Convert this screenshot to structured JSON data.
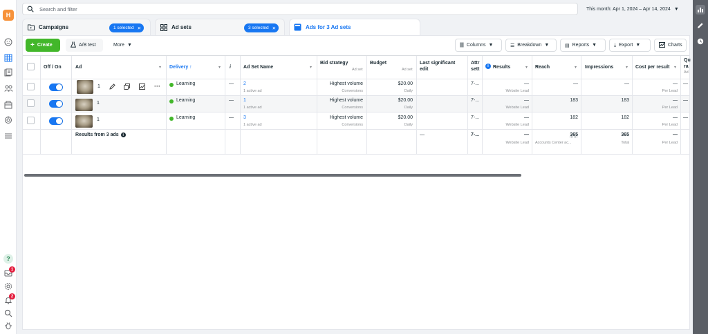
{
  "leftnav": {
    "brand_letter": "H",
    "badges": {
      "notifications_1": "1",
      "notifications_2": "2"
    },
    "help_glyph": "?"
  },
  "search": {
    "placeholder": "Search and filter"
  },
  "date_range": "This month: Apr 1, 2024 – Apr 14, 2024",
  "tabs": [
    {
      "label": "Campaigns",
      "icon": "folder-icon",
      "selected": "1 selected"
    },
    {
      "label": "Ad sets",
      "icon": "grid-icon",
      "selected": "3 selected"
    },
    {
      "label": "Ads for 3 Ad sets",
      "icon": "ad-icon"
    }
  ],
  "toolbar": {
    "create": "Create",
    "ab_test": "A/B test",
    "more": "More",
    "columns": "Columns",
    "breakdown": "Breakdown",
    "reports": "Reports",
    "export": "Export",
    "charts": "Charts"
  },
  "table": {
    "headers": {
      "off_on": "Off / On",
      "ad": "Ad",
      "delivery": "Delivery ↑",
      "info": "i",
      "ad_set_name": "Ad Set Name",
      "bid_strategy": "Bid strategy",
      "bid_strategy_sub": "Ad set",
      "budget": "Budget",
      "budget_sub": "Ad set",
      "last_edit_1": "Last significant",
      "last_edit_2": "edit",
      "attr_1": "Attr",
      "attr_2": "sett",
      "results": "Results",
      "reach": "Reach",
      "impressions": "Impressions",
      "cost_per_result": "Cost per result",
      "quality_1": "Qu",
      "quality_2": "ra",
      "quality_3": "Ad"
    },
    "rows": [
      {
        "ad": "1",
        "delivery": "Learning",
        "dash": "—",
        "ad_set": "2",
        "ad_set_sub": "1 active ad",
        "bid": "Highest volume",
        "bid_sub": "Conversions",
        "budget": "$20.00",
        "budget_sub": "Daily",
        "attr": "7-...",
        "results": "—",
        "results_sub": "Website Lead",
        "reach": "—",
        "impressions": "—",
        "cost": "—",
        "cost_sub": "Per Lead",
        "quality": "—"
      },
      {
        "ad": "1",
        "delivery": "Learning",
        "dash": "—",
        "ad_set": "1",
        "ad_set_sub": "1 active ad",
        "bid": "Highest volume",
        "bid_sub": "Conversions",
        "budget": "$20.00",
        "budget_sub": "Daily",
        "attr": "7-...",
        "results": "—",
        "results_sub": "Website Lead",
        "reach": "183",
        "impressions": "183",
        "cost": "—",
        "cost_sub": "Per Lead",
        "quality": "—"
      },
      {
        "ad": "1",
        "delivery": "Learning",
        "dash": "—",
        "ad_set": "3",
        "ad_set_sub": "1 active ad",
        "bid": "Highest volume",
        "bid_sub": "Conversions",
        "budget": "$20.00",
        "budget_sub": "Daily",
        "attr": "7-...",
        "results": "—",
        "results_sub": "Website Lead",
        "reach": "182",
        "impressions": "182",
        "cost": "—",
        "cost_sub": "Per Lead",
        "quality": "—"
      }
    ],
    "summary": {
      "label": "Results from 3 ads",
      "last_edit": "—",
      "attr": "7-...",
      "results": "—",
      "results_sub": "Website Lead",
      "reach": "365",
      "reach_sub": "Accounts Center ac...",
      "impressions": "365",
      "impressions_sub": "Total",
      "cost": "—",
      "cost_sub": "Per Lead"
    }
  },
  "colors": {
    "accent": "#1877f2",
    "create": "#42b72a",
    "learning": "#42b72a",
    "brand": "#f7923a",
    "badge": "#e41e3f"
  }
}
